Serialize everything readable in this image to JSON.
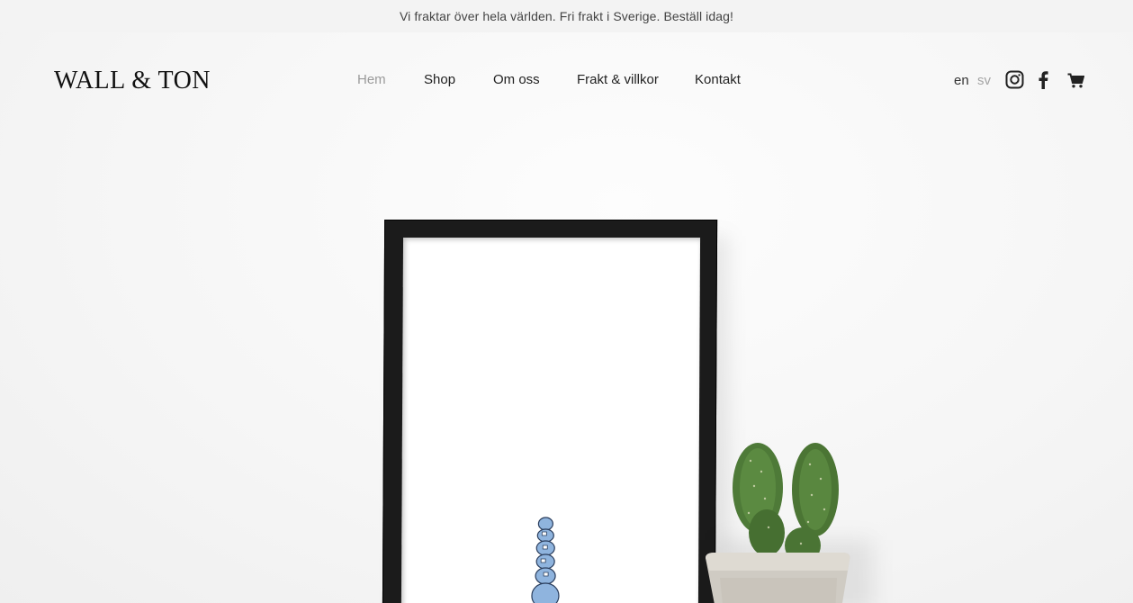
{
  "announcement": {
    "text": "Vi fraktar över hela världen. Fri frakt i Sverige. Beställ idag!"
  },
  "brand": {
    "logo_text": "WALL & TON"
  },
  "nav": {
    "items": [
      {
        "label": "Hem",
        "active": true
      },
      {
        "label": "Shop",
        "active": false
      },
      {
        "label": "Om oss",
        "active": false
      },
      {
        "label": "Frakt & villkor",
        "active": false
      },
      {
        "label": "Kontakt",
        "active": false
      }
    ]
  },
  "languages": {
    "en": "en",
    "sv": "sv",
    "active": "en"
  },
  "icons": {
    "instagram": "instagram-icon",
    "facebook": "facebook-icon",
    "cart": "cart-icon"
  },
  "colors": {
    "announcement_bg": "#f3f3f3",
    "active_nav": "#9a9a9a",
    "text": "#222222"
  }
}
